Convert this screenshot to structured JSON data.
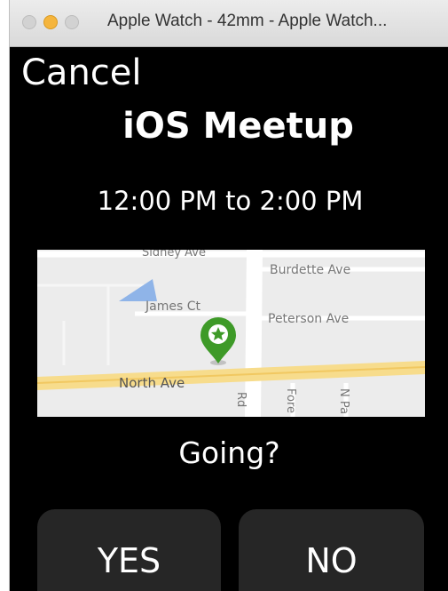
{
  "window": {
    "title": "Apple Watch - 42mm - Apple Watch..."
  },
  "screen": {
    "cancel_label": "Cancel",
    "event_title": "iOS Meetup",
    "event_time": "12:00 PM to 2:00 PM",
    "question": "Going?",
    "yes_label": "YES",
    "no_label": "NO"
  },
  "map": {
    "streets": {
      "sidney": "Sidney Ave",
      "burdette": "Burdette Ave",
      "james": "James Ct",
      "peterson": "Peterson Ave",
      "north": "North Ave",
      "rd": "Rd",
      "fore": "Fore",
      "np": "N Pa"
    },
    "pin_icon": "map-pin-star-icon",
    "colors": {
      "pin": "#3e9a28",
      "highway": "#f7dc8c",
      "water": "#8fb4e8"
    }
  }
}
